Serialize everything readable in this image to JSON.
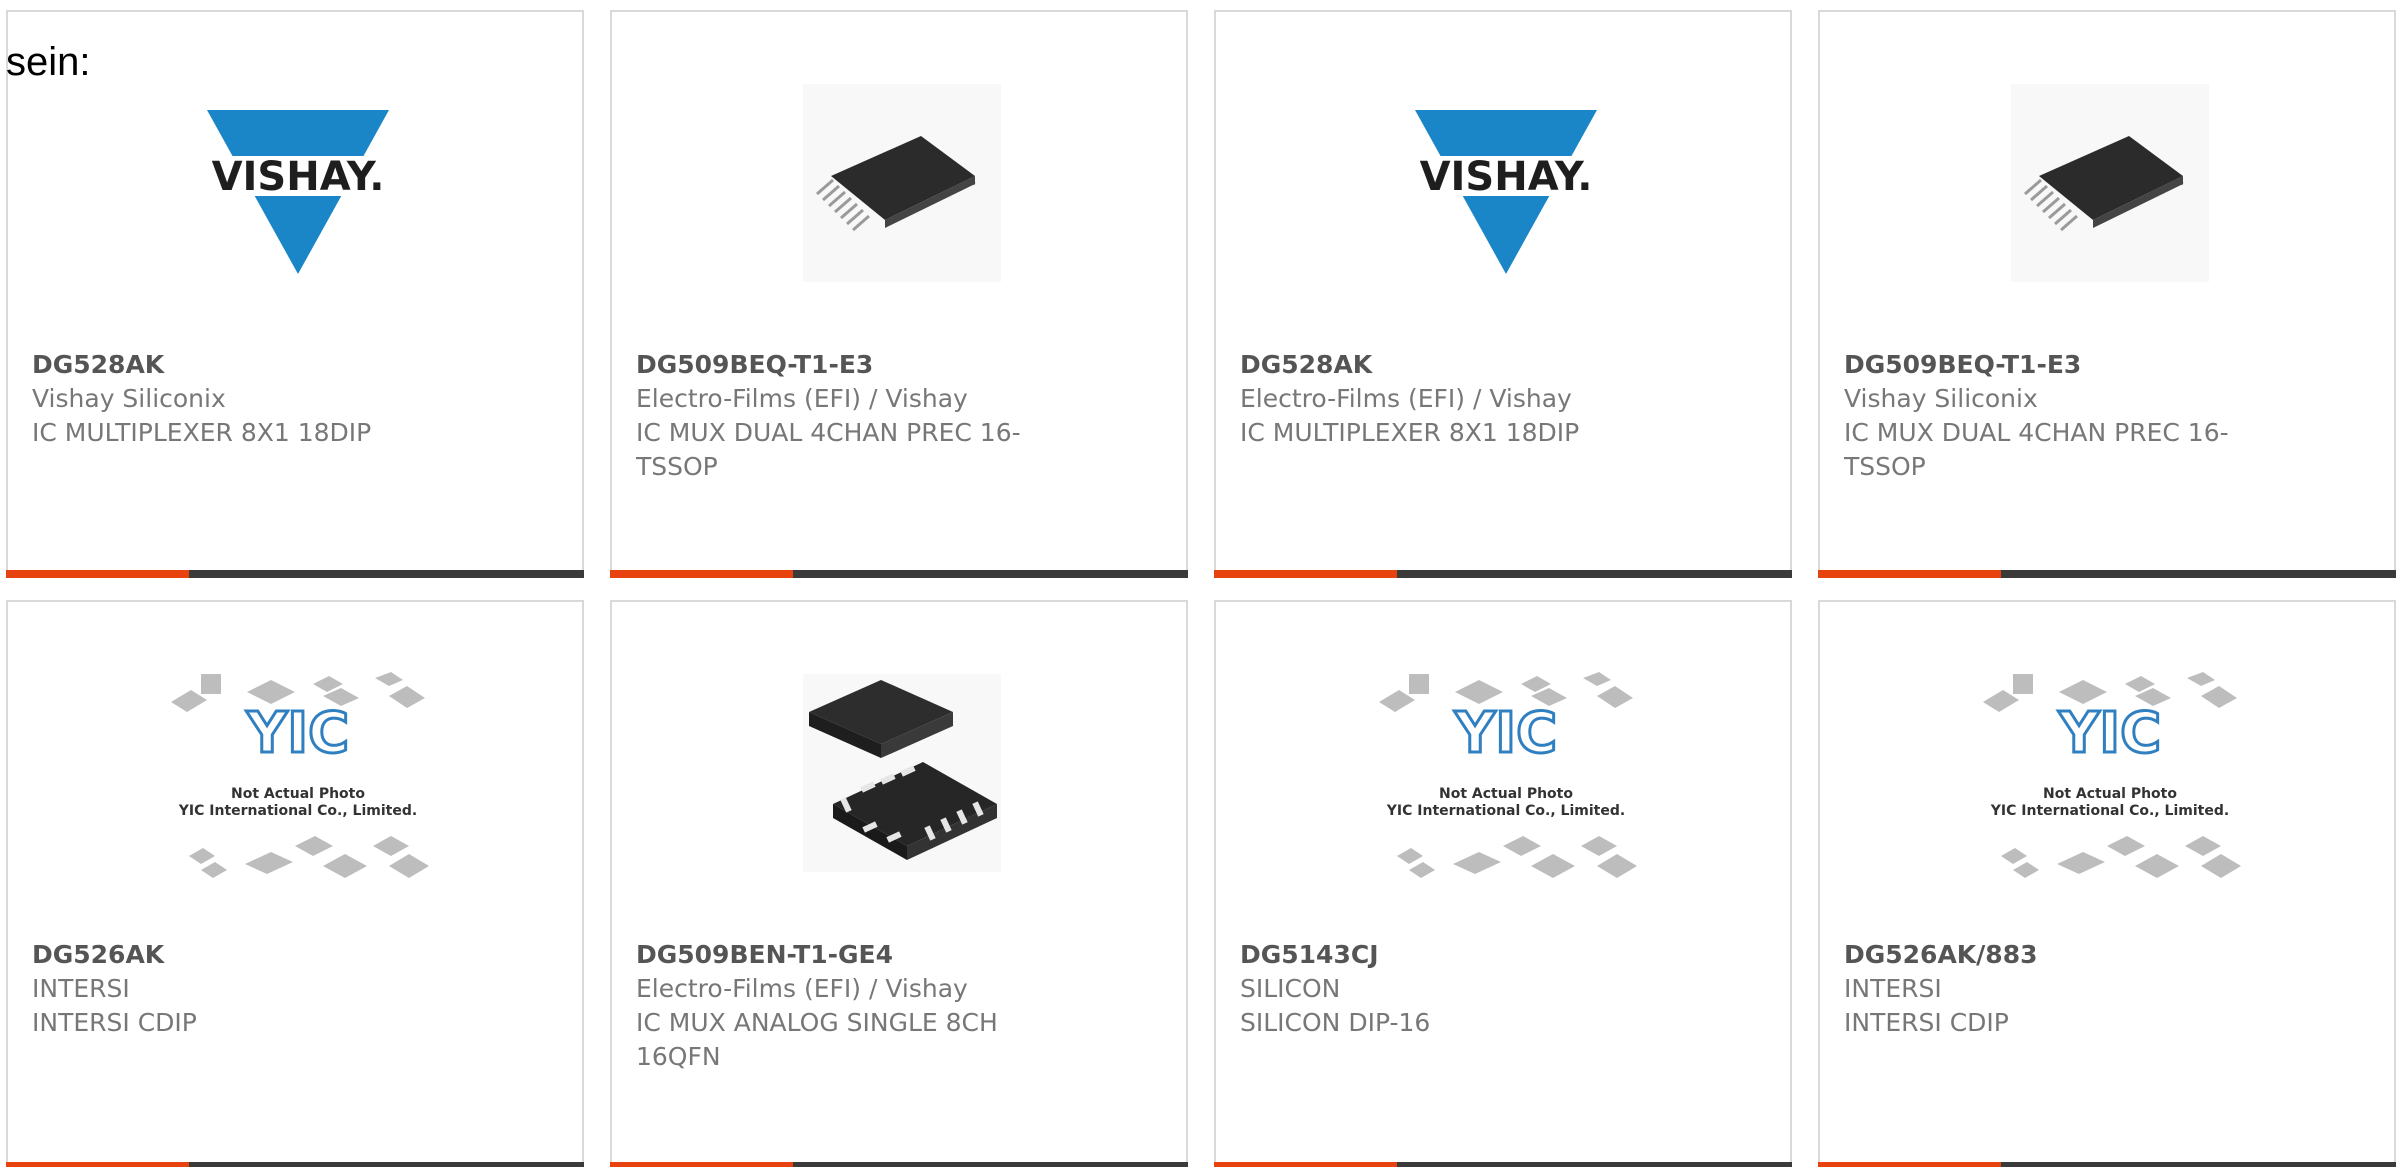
{
  "intro_text": "sein:",
  "colors": {
    "accent": "#e8430e",
    "dark_bar": "#3a3a3a",
    "vishay_blue": "#1a86c8",
    "yic_blue": "#2f7fc1"
  },
  "products": [
    {
      "part_number": "DG528AK",
      "manufacturer": "Vishay Siliconix",
      "description": "IC MULTIPLEXER 8X1 18DIP",
      "image": "vishay-logo",
      "image_text": "VISHAY."
    },
    {
      "part_number": "DG509BEQ-T1-E3",
      "manufacturer": "Electro-Films (EFI) / Vishay",
      "description": "IC MUX DUAL 4CHAN PREC 16-TSSOP",
      "image": "tssop-chip"
    },
    {
      "part_number": "DG528AK",
      "manufacturer": "Electro-Films (EFI) / Vishay",
      "description": "IC MULTIPLEXER 8X1 18DIP",
      "image": "vishay-logo",
      "image_text": "VISHAY."
    },
    {
      "part_number": "DG509BEQ-T1-E3",
      "manufacturer": "Vishay Siliconix",
      "description": "IC MUX DUAL 4CHAN PREC 16-TSSOP",
      "image": "tssop-chip"
    },
    {
      "part_number": "DG526AK",
      "manufacturer": "INTERSI",
      "description": "INTERSI CDIP",
      "image": "not-actual-photo",
      "image_text": [
        "Not Actual Photo",
        "YIC International Co., Limited."
      ]
    },
    {
      "part_number": "DG509BEN-T1-GE4",
      "manufacturer": "Electro-Films (EFI) / Vishay",
      "description": "IC MUX ANALOG SINGLE 8CH 16QFN",
      "image": "qfn-chip"
    },
    {
      "part_number": "DG5143CJ",
      "manufacturer": "SILICON",
      "description": "SILICON DIP-16",
      "image": "not-actual-photo",
      "image_text": [
        "Not Actual Photo",
        "YIC International Co., Limited."
      ]
    },
    {
      "part_number": "DG526AK/883",
      "manufacturer": "INTERSI",
      "description": "INTERSI CDIP",
      "image": "not-actual-photo",
      "image_text": [
        "Not Actual Photo",
        "YIC International Co., Limited."
      ]
    }
  ]
}
